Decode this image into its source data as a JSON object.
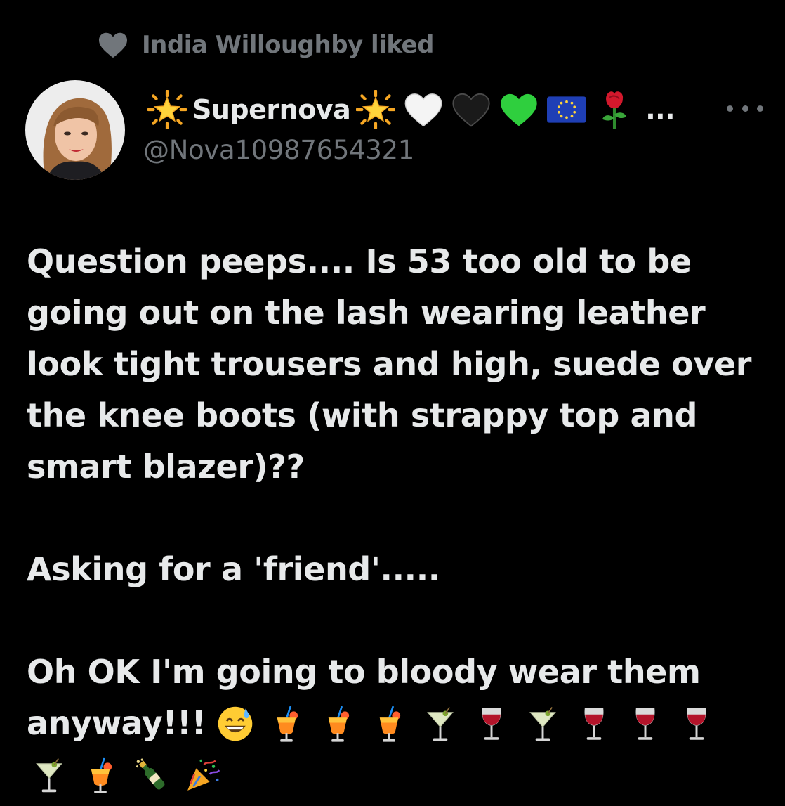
{
  "social_context": {
    "icon": "heart-icon",
    "label": "India Willoughby liked"
  },
  "author": {
    "display_name": "Supernova",
    "name_emojis_before": [
      "glowing-star"
    ],
    "name_emojis_after": [
      "glowing-star",
      "white-heart",
      "black-heart",
      "green-heart",
      "eu-flag",
      "rose"
    ],
    "truncation": "...",
    "handle": "@Nova10987654321",
    "avatar": "avatar-photo"
  },
  "tweet": {
    "lines": [
      "Question peeps.... Is 53 too old to be",
      "going out on the lash wearing leather",
      "look tight trousers and high, suede over",
      "the knee boots (with strappy top and",
      "smart blazer)??"
    ],
    "paragraph2": "Asking for a 'friend'.....",
    "paragraph3_line1": "Oh OK I'm going to bloody wear them",
    "paragraph3_line2_text": "anyway!!!",
    "emoji_line1": [
      "grinning-face-with-sweat",
      "tropical-drink",
      "tropical-drink",
      "tropical-drink",
      "cocktail-glass",
      "wine-glass",
      "cocktail-glass",
      "wine-glass",
      "wine-glass",
      "wine-glass"
    ],
    "emoji_line2": [
      "cocktail-glass",
      "tropical-drink",
      "champagne-bottle",
      "party-popper"
    ]
  },
  "colors": {
    "background": "#000000",
    "primary_text": "#e7e9ea",
    "secondary_text": "#71767b"
  }
}
